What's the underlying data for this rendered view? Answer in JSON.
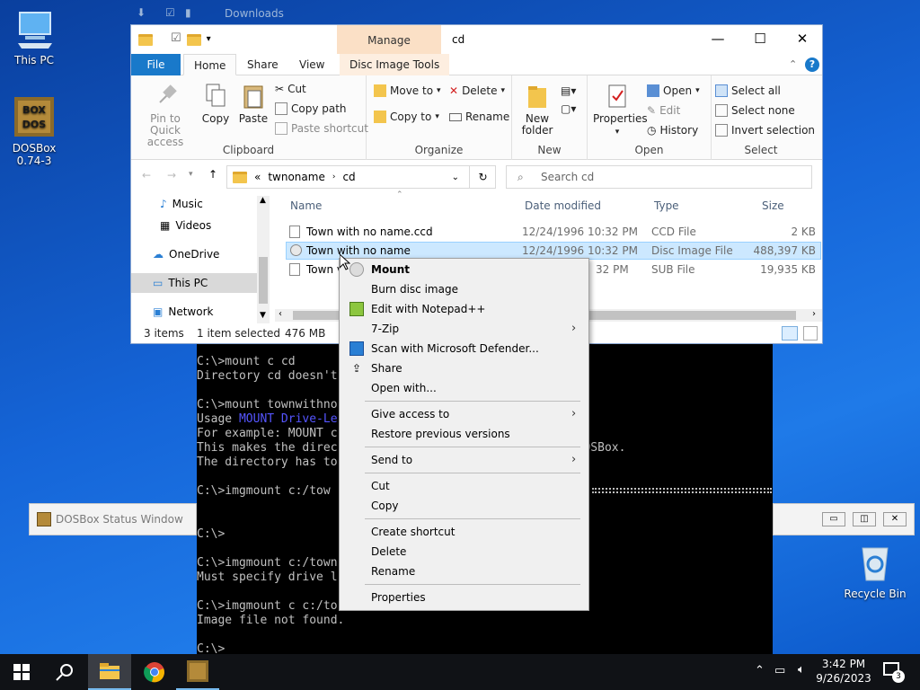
{
  "desktop": {
    "icons": [
      {
        "label": "This PC"
      },
      {
        "label": "DOSBox 0.74-3"
      },
      {
        "label": "Recycle Bin"
      }
    ]
  },
  "background_window": {
    "title": "Downloads"
  },
  "explorer": {
    "title": "cd",
    "contextual_tab": "Manage",
    "tabs": [
      "File",
      "Home",
      "Share",
      "View",
      "Disc Image Tools"
    ],
    "ribbon": {
      "clipboard": {
        "label": "Clipboard",
        "pin": "Pin to Quick access",
        "copy": "Copy",
        "paste": "Paste",
        "cut": "Cut",
        "copy_path": "Copy path",
        "paste_shortcut": "Paste shortcut"
      },
      "organize": {
        "label": "Organize",
        "move_to": "Move to",
        "copy_to": "Copy to",
        "delete": "Delete",
        "rename": "Rename"
      },
      "new": {
        "label": "New",
        "new_folder": "New folder"
      },
      "open": {
        "label": "Open",
        "properties": "Properties",
        "open": "Open",
        "edit": "Edit",
        "history": "History"
      },
      "select": {
        "label": "Select",
        "select_all": "Select all",
        "select_none": "Select none",
        "invert": "Invert selection"
      }
    },
    "address": {
      "prefix": "«",
      "parent": "twnoname",
      "current": "cd"
    },
    "search_placeholder": "Search cd",
    "nav": [
      {
        "label": "Music"
      },
      {
        "label": "Videos"
      },
      {
        "label": "OneDrive"
      },
      {
        "label": "This PC"
      },
      {
        "label": "Network"
      }
    ],
    "columns": {
      "name": "Name",
      "date": "Date modified",
      "type": "Type",
      "size": "Size"
    },
    "files": [
      {
        "name": "Town with no name.ccd",
        "date": "12/24/1996 10:32 PM",
        "type": "CCD File",
        "size": "2 KB"
      },
      {
        "name": "Town with no name",
        "date": "12/24/1996 10:32 PM",
        "type": "Disc Image File",
        "size": "488,397 KB"
      },
      {
        "name": "Town v",
        "date": "32 PM",
        "type": "SUB File",
        "size": "19,935 KB"
      }
    ],
    "status": {
      "count": "3 items",
      "selected": "1 item selected",
      "size": "476 MB"
    }
  },
  "console": {
    "lines": [
      "C:\\>mount c cd",
      "Directory cd doesn't",
      "",
      "C:\\>mount townwithno",
      "Usage ",
      "For example: MOUNT c",
      "This makes the direc                        ve inside DOSBox.",
      "The directory has to",
      "",
      "C:\\>imgmount c:/tow",
      "",
      "",
      "C:\\>",
      "",
      "C:\\>imgmount c:/town",
      "Must specify drive l",
      "",
      "C:\\>imgmount c c:/to",
      "Image file not found.",
      "",
      "C:\\>"
    ],
    "usage_highlight": "MOUNT Drive-Le"
  },
  "status_window": {
    "title": "DOSBox Status Window"
  },
  "context_menu": {
    "items": [
      {
        "label": "Mount",
        "icon": "disc-icon"
      },
      {
        "label": "Burn disc image"
      },
      {
        "label": "Edit with Notepad++",
        "icon": "notepad-icon"
      },
      {
        "label": "7-Zip"
      },
      {
        "label": "Scan with Microsoft Defender...",
        "icon": "defender-icon"
      },
      {
        "label": "Share",
        "icon": "share-icon"
      },
      {
        "label": "Open with..."
      },
      {
        "label": "Give access to"
      },
      {
        "label": "Restore previous versions"
      },
      {
        "label": "Send to"
      },
      {
        "label": "Cut"
      },
      {
        "label": "Copy"
      },
      {
        "label": "Create shortcut"
      },
      {
        "label": "Delete"
      },
      {
        "label": "Rename"
      },
      {
        "label": "Properties"
      }
    ]
  },
  "taskbar": {
    "time": "3:42 PM",
    "date": "9/26/2023",
    "notification_count": "3"
  },
  "colors": {
    "accent": "#1979ca",
    "selection": "#cce8ff",
    "manage_tab": "#fbe0c6"
  }
}
